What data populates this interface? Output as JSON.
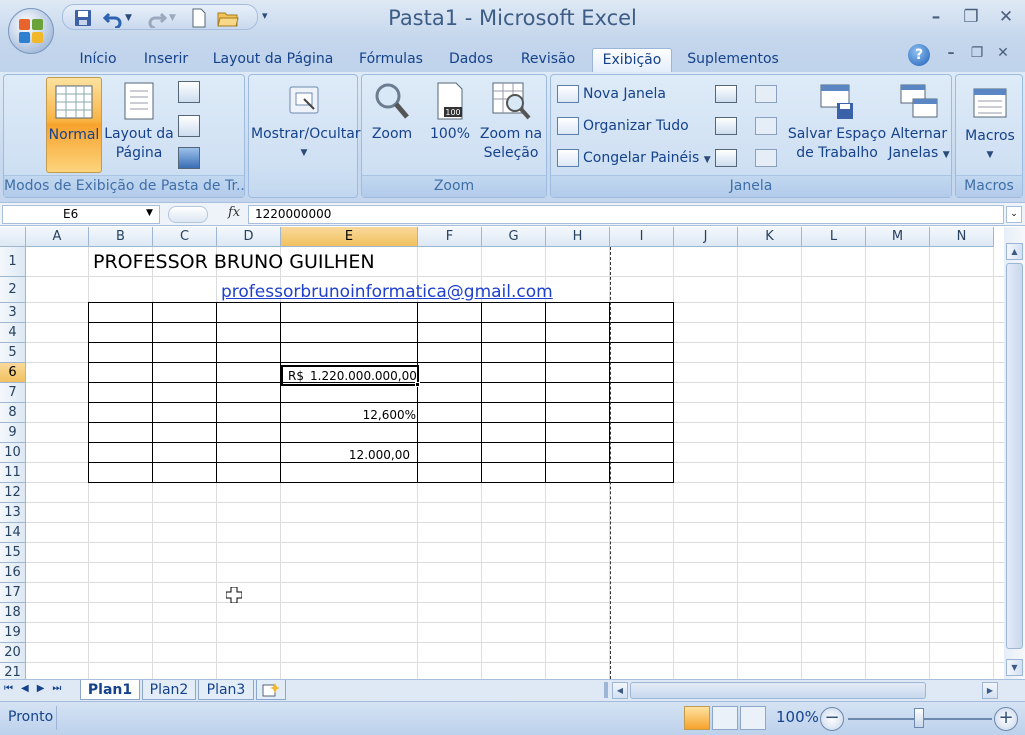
{
  "window": {
    "title": "Pasta1 - Microsoft Excel"
  },
  "tabs": [
    "Início",
    "Inserir",
    "Layout da Página",
    "Fórmulas",
    "Dados",
    "Revisão",
    "Exibição",
    "Suplementos"
  ],
  "ribbon": {
    "views": {
      "normal": "Normal",
      "layout": "Layout da",
      "layout2": "Página",
      "label": "Modos de Exibição de Pasta de Tr..."
    },
    "show": {
      "label": "Mostrar/Ocultar"
    },
    "zoom": {
      "zoom": "Zoom",
      "hundred": "100%",
      "zsel1": "Zoom na",
      "zsel2": "Seleção",
      "label": "Zoom"
    },
    "window": {
      "nova": "Nova Janela",
      "organizar": "Organizar Tudo",
      "congelar": "Congelar Painéis",
      "salvar1": "Salvar Espaço",
      "salvar2": "de Trabalho",
      "alternar1": "Alternar",
      "alternar2": "Janelas",
      "label": "Janela"
    },
    "macros": {
      "btn": "Macros",
      "label": "Macros"
    }
  },
  "formula": {
    "namebox": "E6",
    "fx": "fx",
    "value": "1220000000"
  },
  "columns": [
    "A",
    "B",
    "C",
    "D",
    "E",
    "F",
    "G",
    "H",
    "I",
    "J",
    "K",
    "L",
    "M",
    "N"
  ],
  "rows": [
    "1",
    "2",
    "3",
    "4",
    "5",
    "6",
    "7",
    "8",
    "9",
    "10",
    "11",
    "12",
    "13",
    "14",
    "15",
    "16",
    "17",
    "18",
    "19",
    "20",
    "21"
  ],
  "cells": {
    "b1": "PROFESSOR BRUNO GUILHEN",
    "d2": "professorbrunoinformatica@gmail.com",
    "e6_symbol": "R$",
    "e6_value": "1.220.000.000,00",
    "e8": "12,600%",
    "e10": "12.000,00"
  },
  "sheets": [
    "Plan1",
    "Plan2",
    "Plan3"
  ],
  "status": {
    "mode": "Pronto",
    "zoom": "100%"
  }
}
